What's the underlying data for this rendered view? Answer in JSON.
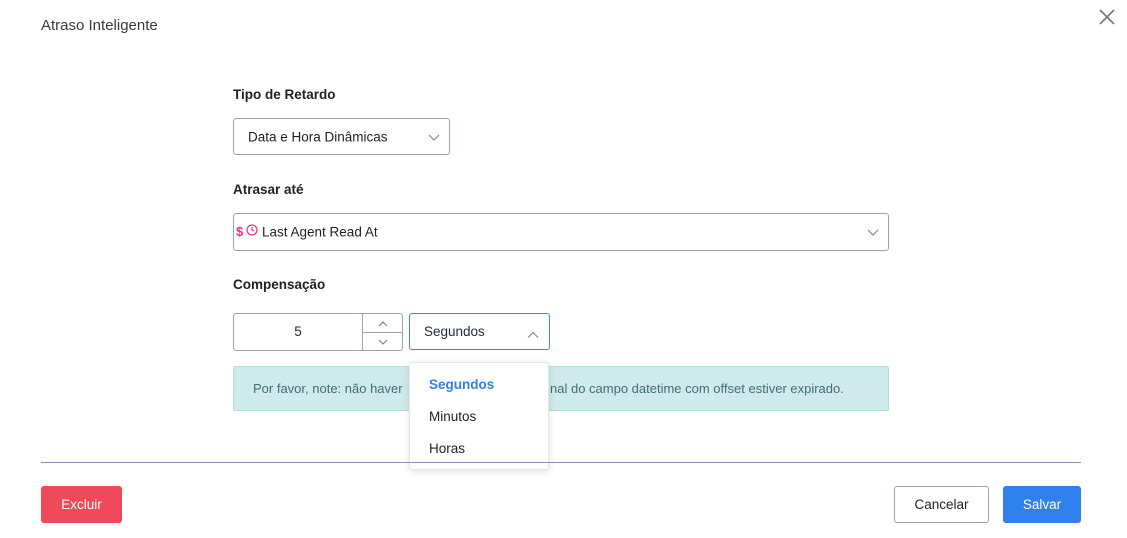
{
  "dialog": {
    "title": "Atraso Inteligente"
  },
  "delay_type": {
    "label": "Tipo de Retardo",
    "value": "Data e Hora Dinâmicas"
  },
  "delay_until": {
    "label": "Atrasar até",
    "prefix_symbol": "$",
    "value": "Last Agent Read At"
  },
  "offset": {
    "label": "Compensação",
    "amount": "5",
    "unit": "Segundos",
    "options": [
      "Segundos",
      "Minutos",
      "Horas"
    ],
    "selected_option": "Segundos"
  },
  "note": {
    "text_left": "Por favor, note: não haver",
    "text_right": "nal do campo datetime com offset estiver expirado."
  },
  "footer": {
    "delete_label": "Excluir",
    "cancel_label": "Cancelar",
    "save_label": "Salvar"
  },
  "colors": {
    "primary": "#2f80ed",
    "danger": "#f04a5a",
    "note_bg": "#cfeaec",
    "variable_pink": "#e0338c"
  }
}
